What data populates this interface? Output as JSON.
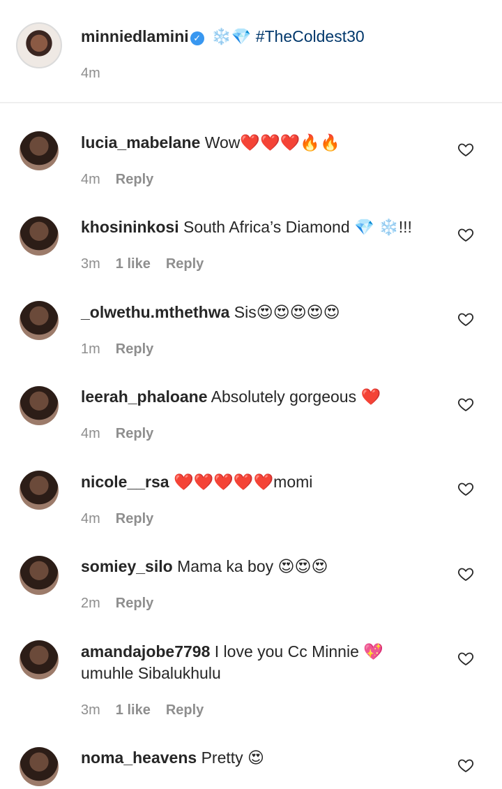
{
  "caption": {
    "username": "minniedlamini",
    "verified": true,
    "emoji": "❄️💎",
    "hashtag": "#TheColdest30",
    "time": "4m"
  },
  "comments": [
    {
      "username": "lucia_mabelane",
      "text": "Wow❤️❤️❤️🔥🔥",
      "time": "4m",
      "likes": "",
      "reply_label": "Reply"
    },
    {
      "username": "khosininkosi",
      "text": "South Africa’s Diamond 💎 ❄️!!!",
      "time": "3m",
      "likes": "1 like",
      "reply_label": "Reply"
    },
    {
      "username": "_olwethu.mthethwa",
      "text": "Sis😍😍😍😍😍",
      "time": "1m",
      "likes": "",
      "reply_label": "Reply"
    },
    {
      "username": "leerah_phaloane",
      "text": "Absolutely gorgeous ❤️",
      "time": "4m",
      "likes": "",
      "reply_label": "Reply"
    },
    {
      "username": "nicole__rsa",
      "text": "❤️❤️❤️❤️❤️momi",
      "time": "4m",
      "likes": "",
      "reply_label": "Reply"
    },
    {
      "username": "somiey_silo",
      "text": "Mama ka boy 😍😍😍",
      "time": "2m",
      "likes": "",
      "reply_label": "Reply"
    },
    {
      "username": "amandajobe7798",
      "text": "I love you Cc Minnie 💖 umuhle Sibalukhulu",
      "time": "3m",
      "likes": "1 like",
      "reply_label": "Reply"
    },
    {
      "username": "noma_heavens",
      "text": "Pretty 😍",
      "time": "",
      "likes": "",
      "reply_label": ""
    }
  ]
}
